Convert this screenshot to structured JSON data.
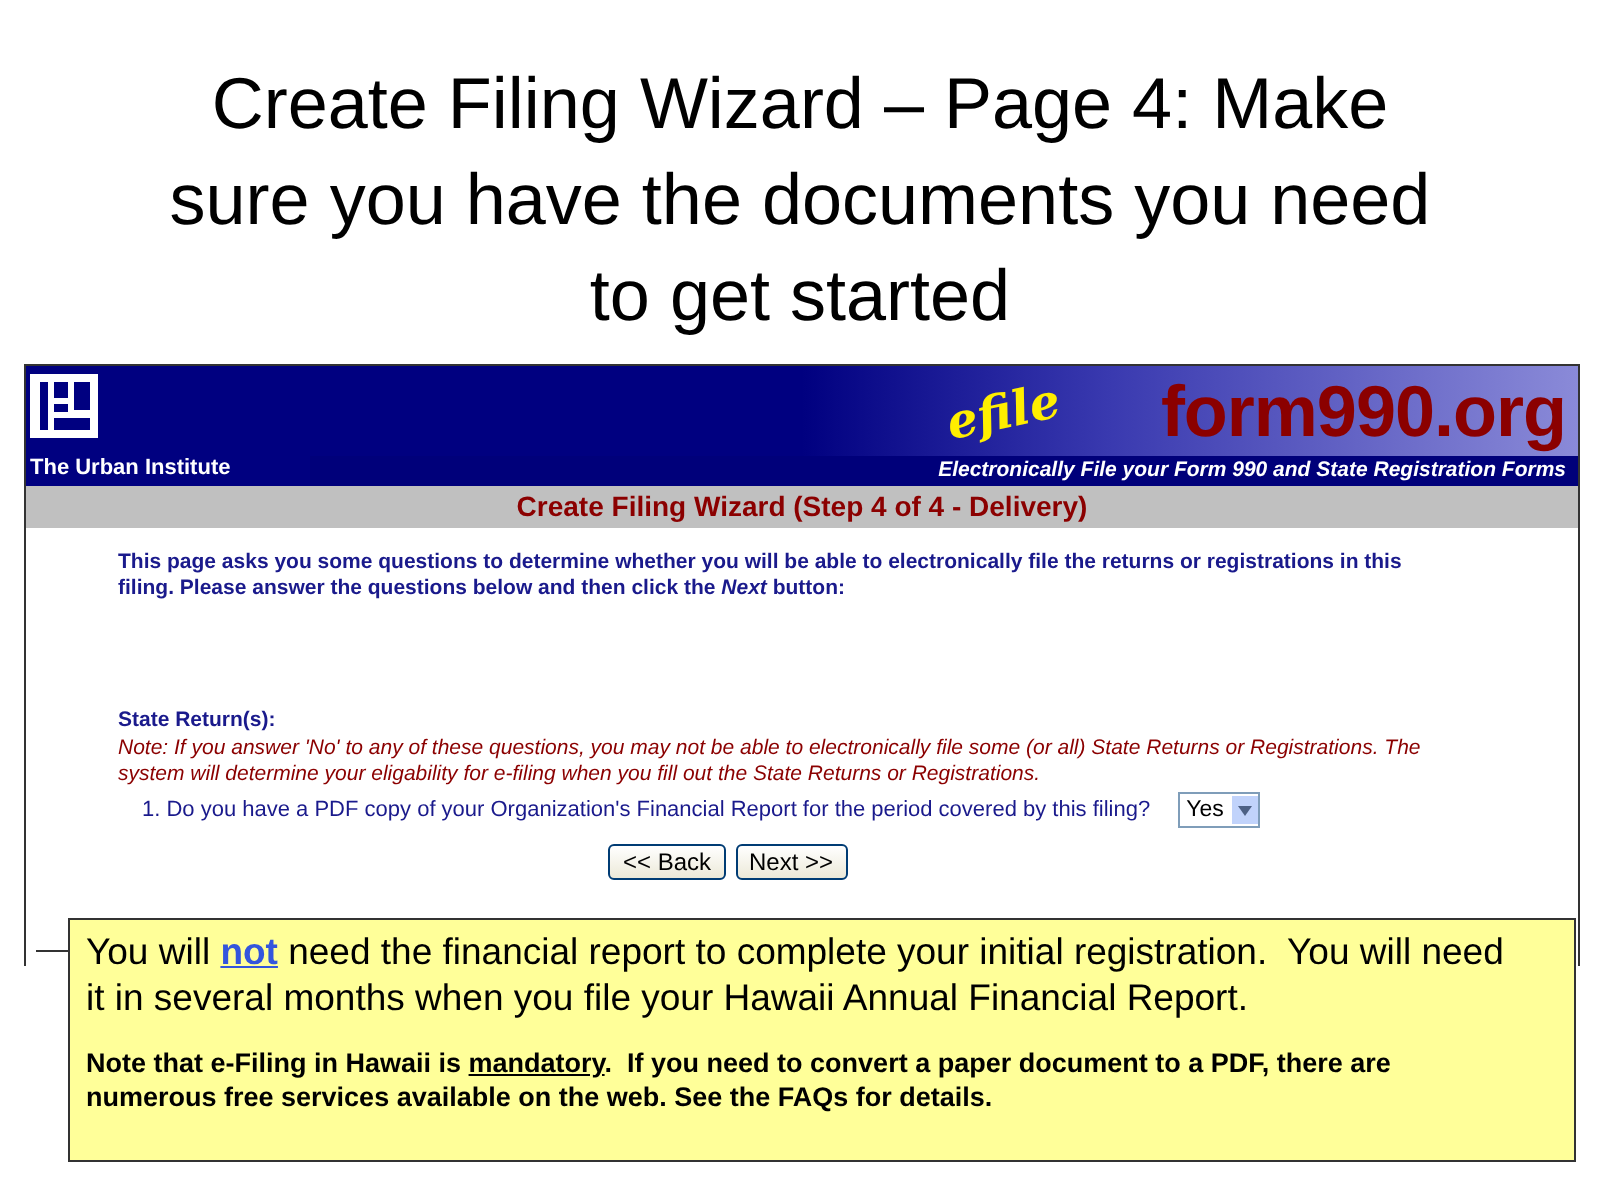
{
  "slide_title": "Create Filing Wizard – Page 4: Make sure you have the documents you need to get started",
  "header": {
    "organization": "The Urban Institute",
    "efile_mark": "efile",
    "site_name": "form990.org",
    "tagline": "Electronically File your Form 990 and State Registration Forms"
  },
  "wizard_title": "Create Filing Wizard (Step 4 of 4 - Delivery)",
  "intro": "This page asks you some questions to determine whether you will be able to electronically file the returns or registrations in this filing. Please answer the questions below and then click the *Next* button:",
  "section": {
    "heading": "State Return(s):",
    "note": "Note: If you answer 'No' to any of these questions, you may not be able to electronically file some (or all) State Returns or Registrations. The system will determine your eligability for e-filing when you fill out the State Returns or Registrations.",
    "questions": [
      {
        "number": "1.",
        "text": "Do you have a PDF copy of your Organization's Financial Report for the period covered by this filing?",
        "answer": "Yes"
      }
    ]
  },
  "buttons": [
    "<< Back",
    "Next >>"
  ],
  "callout": {
    "main": [
      {
        "kind": "plain",
        "text": "You will "
      },
      {
        "kind": "link",
        "text": "not"
      },
      {
        "kind": "plain",
        "text": " need the financial report to complete your initial registration.  You will need it in several months when you file your Hawaii Annual Financial Report."
      }
    ],
    "note": [
      {
        "kind": "plain",
        "text": "Note that e-Filing in Hawaii is "
      },
      {
        "kind": "underline",
        "text": "mandatory"
      },
      {
        "kind": "plain",
        "text": ".  If you need to convert a paper document to a PDF, there are numerous free services available on the web. See the FAQs for details."
      }
    ]
  }
}
